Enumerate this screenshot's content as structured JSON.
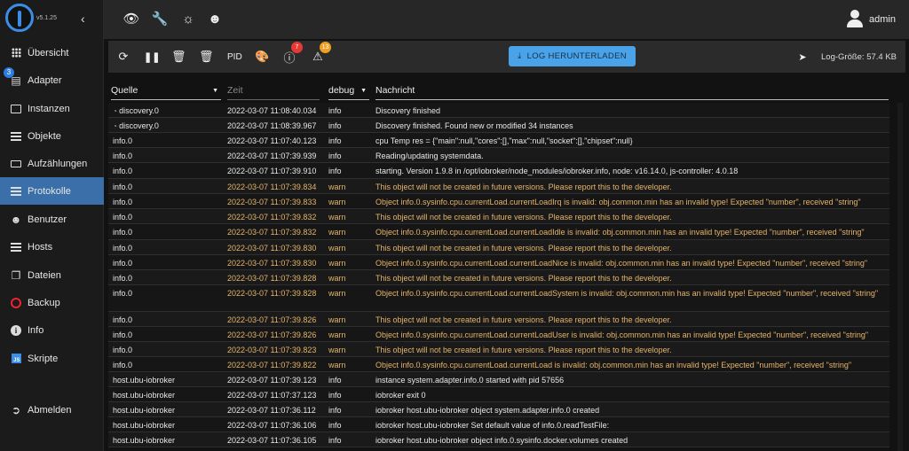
{
  "app": {
    "version": "v5.1.25"
  },
  "sidebar": {
    "items": [
      {
        "label": "Übersicht",
        "icon": "grid-icon"
      },
      {
        "label": "Adapter",
        "icon": "store-icon",
        "badge": "3"
      },
      {
        "label": "Instanzen",
        "icon": "instances-icon"
      },
      {
        "label": "Objekte",
        "icon": "list-icon"
      },
      {
        "label": "Aufzählungen",
        "icon": "enum-icon"
      },
      {
        "label": "Protokolle",
        "icon": "list-icon"
      },
      {
        "label": "Benutzer",
        "icon": "user-icon"
      },
      {
        "label": "Hosts",
        "icon": "list-icon"
      },
      {
        "label": "Dateien",
        "icon": "files-icon"
      },
      {
        "label": "Backup",
        "icon": "backup-icon"
      },
      {
        "label": "Info",
        "icon": "info-icon"
      },
      {
        "label": "Skripte",
        "icon": "js-icon"
      }
    ],
    "logout": "Abmelden"
  },
  "topbar": {
    "user": "admin"
  },
  "toolbar": {
    "pid_label": "PID",
    "error_count": "7",
    "warn_count": "13",
    "download_label": "LOG HERUNTERLADEN",
    "log_size": "Log-Größe: 57.4 KB",
    "colors": {
      "error_badge": "#e53935",
      "warn_badge": "#f0a020",
      "download_bg": "#4aa3e8"
    }
  },
  "table": {
    "headers": {
      "source": "Quelle",
      "time": "Zeit",
      "severity": "debug",
      "message": "Nachricht"
    },
    "rows": [
      {
        "source": "discovery.0",
        "icon": true,
        "time": "2022-03-07 11:08:40.034",
        "severity": "info",
        "message": "Discovery finished"
      },
      {
        "source": "discovery.0",
        "icon": true,
        "time": "2022-03-07 11:08:39.967",
        "severity": "info",
        "message": "Discovery finished. Found new or modified 34 instances"
      },
      {
        "source": "info.0",
        "time": "2022-03-07 11:07:40.123",
        "severity": "info",
        "message": "cpu Temp res = {\"main\":null,\"cores\":[],\"max\":null,\"socket\":[],\"chipset\":null}"
      },
      {
        "source": "info.0",
        "time": "2022-03-07 11:07:39.939",
        "severity": "info",
        "message": "Reading/updating systemdata."
      },
      {
        "source": "info.0",
        "time": "2022-03-07 11:07:39.910",
        "severity": "info",
        "message": "starting. Version 1.9.8 in /opt/iobroker/node_modules/iobroker.info, node: v16.14.0, js-controller: 4.0.18"
      },
      {
        "source": "info.0",
        "time": "2022-03-07 11:07:39.834",
        "severity": "warn",
        "message": "This object will not be created in future versions. Please report this to the developer."
      },
      {
        "source": "info.0",
        "time": "2022-03-07 11:07:39.833",
        "severity": "warn",
        "message": "Object info.0.sysinfo.cpu.currentLoad.currentLoadIrq is invalid: obj.common.min has an invalid type! Expected \"number\", received \"string\""
      },
      {
        "source": "info.0",
        "time": "2022-03-07 11:07:39.832",
        "severity": "warn",
        "message": "This object will not be created in future versions. Please report this to the developer."
      },
      {
        "source": "info.0",
        "time": "2022-03-07 11:07:39.832",
        "severity": "warn",
        "message": "Object info.0.sysinfo.cpu.currentLoad.currentLoadIdle is invalid: obj.common.min has an invalid type! Expected \"number\", received \"string\""
      },
      {
        "source": "info.0",
        "time": "2022-03-07 11:07:39.830",
        "severity": "warn",
        "message": "This object will not be created in future versions. Please report this to the developer."
      },
      {
        "source": "info.0",
        "time": "2022-03-07 11:07:39.830",
        "severity": "warn",
        "message": "Object info.0.sysinfo.cpu.currentLoad.currentLoadNice is invalid: obj.common.min has an invalid type! Expected \"number\", received \"string\""
      },
      {
        "source": "info.0",
        "time": "2022-03-07 11:07:39.828",
        "severity": "warn",
        "message": "This object will not be created in future versions. Please report this to the developer."
      },
      {
        "source": "info.0",
        "time": "2022-03-07 11:07:39.828",
        "severity": "warn",
        "message": "Object info.0.sysinfo.cpu.currentLoad.currentLoadSystem is invalid: obj.common.min has an invalid type! Expected \"number\", received \"string\""
      },
      {
        "source": "info.0",
        "time": "2022-03-07 11:07:39.826",
        "severity": "warn",
        "message": "This object will not be created in future versions. Please report this to the developer."
      },
      {
        "source": "info.0",
        "time": "2022-03-07 11:07:39.826",
        "severity": "warn",
        "message": "Object info.0.sysinfo.cpu.currentLoad.currentLoadUser is invalid: obj.common.min has an invalid type! Expected \"number\", received \"string\""
      },
      {
        "source": "info.0",
        "time": "2022-03-07 11:07:39.823",
        "severity": "warn",
        "message": "This object will not be created in future versions. Please report this to the developer."
      },
      {
        "source": "info.0",
        "time": "2022-03-07 11:07:39.822",
        "severity": "warn",
        "message": "Object info.0.sysinfo.cpu.currentLoad.currentLoad is invalid: obj.common.min has an invalid type! Expected \"number\", received \"string\""
      },
      {
        "source": "host.ubu-iobroker",
        "time": "2022-03-07 11:07:39.123",
        "severity": "info",
        "message": "instance system.adapter.info.0 started with pid 57656"
      },
      {
        "source": "host.ubu-iobroker",
        "time": "2022-03-07 11:07:37.123",
        "severity": "info",
        "message": "iobroker exit 0"
      },
      {
        "source": "host.ubu-iobroker",
        "time": "2022-03-07 11:07:36.112",
        "severity": "info",
        "message": "iobroker host.ubu-iobroker object system.adapter.info.0 created"
      },
      {
        "source": "host.ubu-iobroker",
        "time": "2022-03-07 11:07:36.106",
        "severity": "info",
        "message": "iobroker host.ubu-iobroker Set default value of info.0.readTestFile:"
      },
      {
        "source": "host.ubu-iobroker",
        "time": "2022-03-07 11:07:36.105",
        "severity": "info",
        "message": "iobroker host.ubu-iobroker object info.0.sysinfo.docker.volumes created"
      }
    ]
  }
}
